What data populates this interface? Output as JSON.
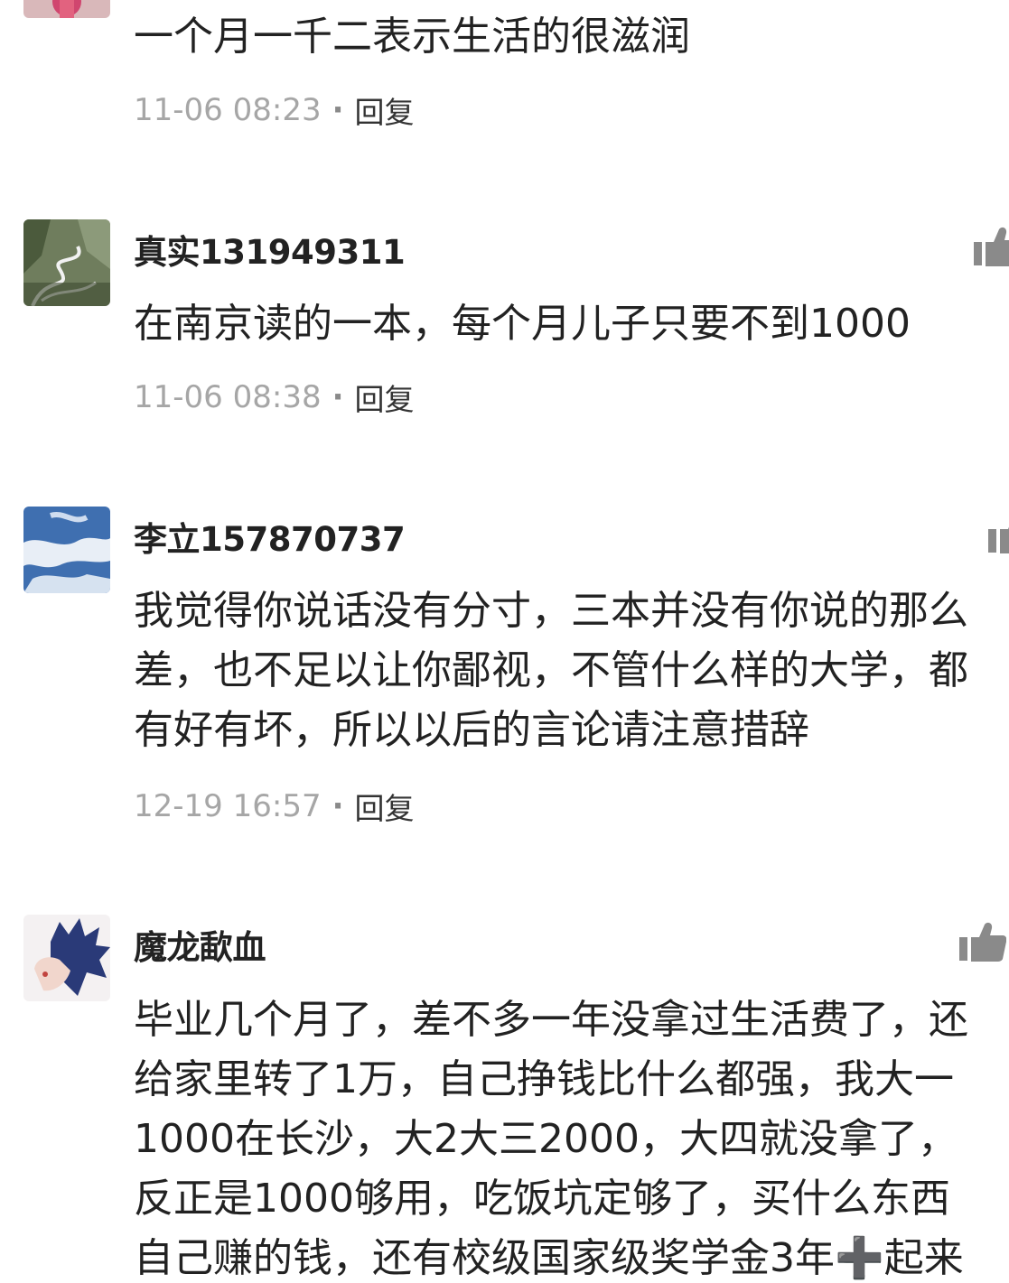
{
  "comments": [
    {
      "content_lines": [
        "一个月一千二表示生活的很滋润"
      ],
      "time": "11-06 08:23",
      "separator": "·",
      "reply_label": "回复"
    },
    {
      "username": "真实131949311",
      "content_lines": [
        "在南京读的一本，每个月儿子只要不到1000"
      ],
      "time": "11-06 08:38",
      "separator": "·",
      "reply_label": "回复",
      "like_icon": "thumbs-up-icon"
    },
    {
      "username": "李立157870737",
      "content_lines": [
        "我觉得你说话没有分寸，三本并没有你说的那么",
        "差，也不足以让你鄙视，不管什么样的大学，都",
        "有好有坏，所以以后的言论请注意措辞"
      ],
      "time": "12-19 16:57",
      "separator": "·",
      "reply_label": "回复",
      "like_icon": "thumbs-up-icon"
    },
    {
      "username": "魔龙歃血",
      "content_lines": [
        "毕业几个月了，差不多一年没拿过生活费了，还",
        "给家里转了1万，自己挣钱比什么都强，我大一",
        "1000在长沙，大2大三2000，大四就没拿了，",
        "反正是1000够用，吃饭坑定够了，买什么东西",
        "自己赚的钱，还有校级国家级奖学金3年➕起来"
      ],
      "like_icon": "thumbs-up-icon"
    }
  ],
  "colors": {
    "text": "#222222",
    "meta": "#a6a6a6",
    "icon": "#888888"
  }
}
